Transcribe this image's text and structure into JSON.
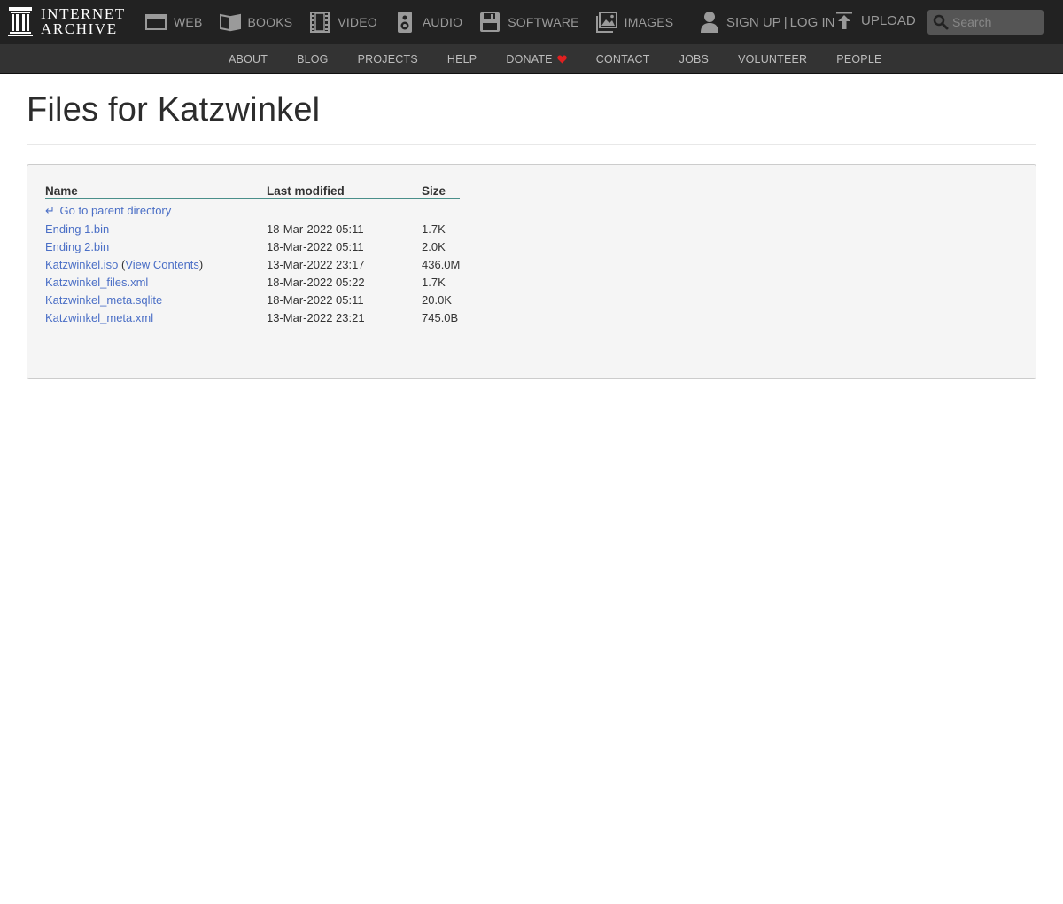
{
  "brand": {
    "line1": "INTERNET",
    "line2": "ARCHIVE"
  },
  "media_nav": [
    {
      "label": "WEB",
      "icon": "web-icon"
    },
    {
      "label": "BOOKS",
      "icon": "book-icon"
    },
    {
      "label": "VIDEO",
      "icon": "film-icon"
    },
    {
      "label": "AUDIO",
      "icon": "speaker-icon"
    },
    {
      "label": "SOFTWARE",
      "icon": "floppy-icon"
    },
    {
      "label": "IMAGES",
      "icon": "image-icon"
    }
  ],
  "user": {
    "signup": "SIGN UP",
    "separator": "|",
    "login": "LOG IN"
  },
  "upload": "UPLOAD",
  "search": {
    "placeholder": "Search"
  },
  "subnav": [
    "ABOUT",
    "BLOG",
    "PROJECTS",
    "HELP",
    "DONATE",
    "CONTACT",
    "JOBS",
    "VOLUNTEER",
    "PEOPLE"
  ],
  "colors": {
    "topbar": "#222222",
    "subnav": "#333333",
    "link": "#4b6fc6",
    "heart": "#e02020"
  },
  "page": {
    "title": "Files for Katzwinkel"
  },
  "table": {
    "headers": {
      "name": "Name",
      "modified": "Last modified",
      "size": "Size"
    },
    "parent": {
      "arrow": "↵",
      "label": "Go to parent directory"
    },
    "files": [
      {
        "name": "Ending 1.bin",
        "modified": "18-Mar-2022 05:11",
        "size": "1.7K"
      },
      {
        "name": "Ending 2.bin",
        "modified": "18-Mar-2022 05:11",
        "size": "2.0K"
      },
      {
        "name": "Katzwinkel.iso",
        "extra_pre": " (",
        "extra_link": "View Contents",
        "extra_post": ")",
        "modified": "13-Mar-2022 23:17",
        "size": "436.0M"
      },
      {
        "name": "Katzwinkel_files.xml",
        "modified": "18-Mar-2022 05:22",
        "size": "1.7K"
      },
      {
        "name": "Katzwinkel_meta.sqlite",
        "modified": "18-Mar-2022 05:11",
        "size": "20.0K"
      },
      {
        "name": "Katzwinkel_meta.xml",
        "modified": "13-Mar-2022 23:21",
        "size": "745.0B"
      }
    ]
  }
}
